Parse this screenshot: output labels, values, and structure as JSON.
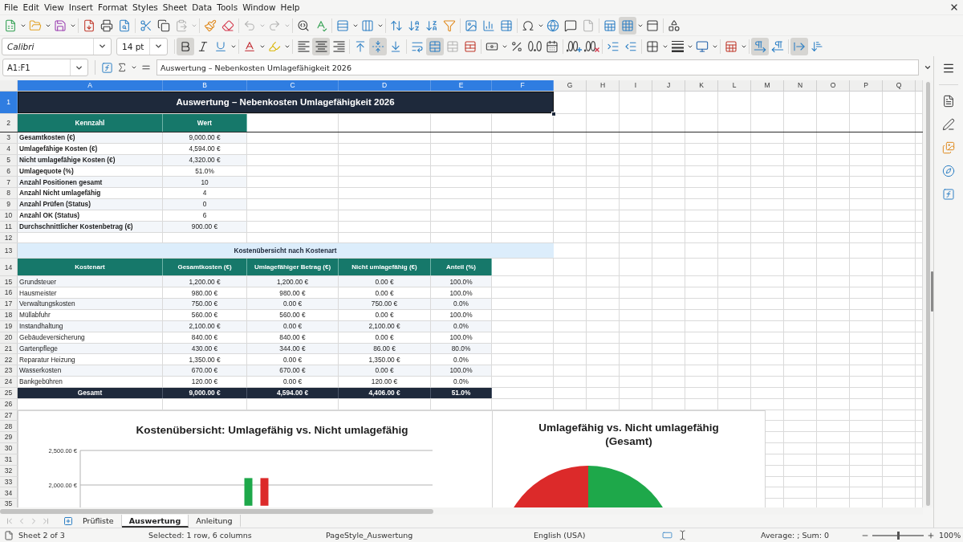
{
  "menu_bar": [
    "File",
    "Edit",
    "View",
    "Insert",
    "Format",
    "Styles",
    "Sheet",
    "Data",
    "Tools",
    "Window",
    "Help"
  ],
  "standard_toolbar": [
    [
      {
        "kind": "new",
        "on": false,
        "disabled": false,
        "dropdown": true
      },
      {
        "kind": "open",
        "on": false,
        "disabled": false,
        "dropdown": true
      },
      {
        "kind": "save",
        "on": false,
        "disabled": false,
        "dropdown": true
      }
    ],
    [
      {
        "kind": "pdf",
        "on": false,
        "disabled": false,
        "dropdown": false
      },
      {
        "kind": "print",
        "on": false,
        "disabled": false,
        "dropdown": false
      },
      {
        "kind": "preview",
        "on": false,
        "disabled": false,
        "dropdown": false
      }
    ],
    [
      {
        "kind": "cut",
        "on": false,
        "disabled": false,
        "dropdown": false
      },
      {
        "kind": "copy",
        "on": false,
        "disabled": false,
        "dropdown": false
      },
      {
        "kind": "paste",
        "on": false,
        "disabled": true,
        "dropdown": true
      }
    ],
    [
      {
        "kind": "clone",
        "on": false,
        "disabled": false,
        "dropdown": false
      },
      {
        "kind": "clear",
        "on": false,
        "disabled": false,
        "dropdown": false
      }
    ],
    [
      {
        "kind": "undo",
        "on": false,
        "disabled": true,
        "dropdown": true
      },
      {
        "kind": "redo",
        "on": false,
        "disabled": true,
        "dropdown": true
      }
    ],
    [
      {
        "kind": "find",
        "on": false,
        "disabled": false,
        "dropdown": false
      },
      {
        "kind": "spelling",
        "on": false,
        "disabled": false,
        "dropdown": false
      }
    ],
    [
      {
        "kind": "rows",
        "on": false,
        "disabled": false,
        "dropdown": true
      },
      {
        "kind": "columns",
        "on": false,
        "disabled": false,
        "dropdown": true
      }
    ],
    [
      {
        "kind": "sort",
        "on": false,
        "disabled": false,
        "dropdown": false
      },
      {
        "kind": "sort_ascending",
        "on": false,
        "disabled": false,
        "dropdown": false
      },
      {
        "kind": "sort_descending",
        "on": false,
        "disabled": false,
        "dropdown": false
      },
      {
        "kind": "autofilter",
        "on": false,
        "disabled": false,
        "dropdown": false
      }
    ],
    [
      {
        "kind": "image",
        "on": false,
        "disabled": false,
        "dropdown": false
      },
      {
        "kind": "chart",
        "on": false,
        "disabled": false,
        "dropdown": false
      },
      {
        "kind": "pivot_table",
        "on": false,
        "disabled": false,
        "dropdown": false
      }
    ],
    [
      {
        "kind": "special_character",
        "on": false,
        "disabled": false,
        "dropdown": true
      },
      {
        "kind": "hyperlink",
        "on": false,
        "disabled": false,
        "dropdown": false
      },
      {
        "kind": "comment",
        "on": false,
        "disabled": false,
        "dropdown": false
      },
      {
        "kind": "header_footer",
        "on": false,
        "disabled": true,
        "dropdown": false
      }
    ],
    [
      {
        "kind": "print_area",
        "on": false,
        "disabled": false,
        "dropdown": false
      },
      {
        "kind": "freeze",
        "on": true,
        "disabled": false,
        "dropdown": true
      },
      {
        "kind": "split_window",
        "on": false,
        "disabled": false,
        "dropdown": false
      }
    ],
    [
      {
        "kind": "draw_functions",
        "on": false,
        "disabled": false,
        "dropdown": false
      }
    ]
  ],
  "formatting_toolbar": {
    "font_name": "Calibri",
    "font_size": "14 pt",
    "groups": [
      [
        {
          "kind": "bold",
          "on": true,
          "disabled": false,
          "dropdown": false
        },
        {
          "kind": "italic",
          "on": false,
          "disabled": false,
          "dropdown": false
        },
        {
          "kind": "underline",
          "on": false,
          "disabled": false,
          "dropdown": true
        }
      ],
      [
        {
          "kind": "font_color",
          "on": false,
          "disabled": false,
          "dropdown": true
        },
        {
          "kind": "highlight",
          "on": false,
          "disabled": false,
          "dropdown": true
        }
      ],
      [
        {
          "kind": "align_left",
          "on": false,
          "disabled": false,
          "dropdown": false
        },
        {
          "kind": "align_center",
          "on": true,
          "disabled": false,
          "dropdown": false
        },
        {
          "kind": "align_right",
          "on": false,
          "disabled": false,
          "dropdown": false
        }
      ],
      [
        {
          "kind": "align_top",
          "on": false,
          "disabled": false,
          "dropdown": false
        },
        {
          "kind": "align_middle",
          "on": true,
          "disabled": false,
          "dropdown": false
        },
        {
          "kind": "align_bottom",
          "on": false,
          "disabled": false,
          "dropdown": false
        }
      ],
      [
        {
          "kind": "wrap_text",
          "on": false,
          "disabled": false,
          "dropdown": false
        },
        {
          "kind": "merge_center",
          "on": true,
          "disabled": false,
          "dropdown": false
        },
        {
          "kind": "merge_cells",
          "on": false,
          "disabled": true,
          "dropdown": false
        },
        {
          "kind": "unmerge_cells",
          "on": false,
          "disabled": false,
          "dropdown": false
        }
      ],
      [
        {
          "kind": "currency",
          "on": false,
          "disabled": false,
          "dropdown": true
        },
        {
          "kind": "percent",
          "on": false,
          "disabled": false,
          "dropdown": false
        },
        {
          "kind": "number",
          "on": false,
          "disabled": false,
          "dropdown": false
        },
        {
          "kind": "date",
          "on": false,
          "disabled": false,
          "dropdown": false
        }
      ],
      [
        {
          "kind": "add_decimal",
          "on": false,
          "disabled": false,
          "dropdown": false
        },
        {
          "kind": "delete_decimal",
          "on": false,
          "disabled": false,
          "dropdown": false
        }
      ],
      [
        {
          "kind": "indent_increase",
          "on": false,
          "disabled": false,
          "dropdown": false
        },
        {
          "kind": "indent_decrease",
          "on": false,
          "disabled": false,
          "dropdown": false
        }
      ],
      [
        {
          "kind": "borders",
          "on": false,
          "disabled": false,
          "dropdown": true
        },
        {
          "kind": "border_style",
          "on": false,
          "disabled": false,
          "dropdown": true
        },
        {
          "kind": "border_color",
          "on": false,
          "disabled": false,
          "dropdown": true
        }
      ],
      [
        {
          "kind": "conditional",
          "on": false,
          "disabled": false,
          "dropdown": true
        }
      ],
      [
        {
          "kind": "left_to_right",
          "on": true,
          "disabled": false,
          "dropdown": false
        },
        {
          "kind": "right_to_left",
          "on": false,
          "disabled": false,
          "dropdown": false
        }
      ],
      [
        {
          "kind": "text_left_to_right",
          "on": true,
          "disabled": false,
          "dropdown": false
        },
        {
          "kind": "text_top_to_bottom",
          "on": false,
          "disabled": false,
          "dropdown": false
        }
      ]
    ]
  },
  "formula_bar": {
    "name_box": "A1:F1",
    "formula": "Auswertung – Nebenkosten Umlagefähigkeit 2026"
  },
  "sheet": {
    "columns": [
      {
        "label": "A",
        "selected": true
      },
      {
        "label": "B",
        "selected": true
      },
      {
        "label": "C",
        "selected": true
      },
      {
        "label": "D",
        "selected": true
      },
      {
        "label": "E",
        "selected": true
      },
      {
        "label": "F",
        "selected": true
      },
      {
        "label": "G",
        "selected": false
      },
      {
        "label": "H",
        "selected": false
      },
      {
        "label": "I",
        "selected": false
      },
      {
        "label": "J",
        "selected": false
      },
      {
        "label": "K",
        "selected": false
      },
      {
        "label": "L",
        "selected": false
      },
      {
        "label": "M",
        "selected": false
      },
      {
        "label": "N",
        "selected": false
      },
      {
        "label": "O",
        "selected": false
      },
      {
        "label": "P",
        "selected": false
      },
      {
        "label": "Q",
        "selected": false
      }
    ],
    "row_numbers": [
      {
        "label": "1",
        "selected": true
      },
      {
        "label": "2",
        "selected": false
      },
      {
        "label": "3",
        "selected": false
      },
      {
        "label": "4",
        "selected": false
      },
      {
        "label": "5",
        "selected": false
      },
      {
        "label": "6",
        "selected": false
      },
      {
        "label": "7",
        "selected": false
      },
      {
        "label": "8",
        "selected": false
      },
      {
        "label": "9",
        "selected": false
      },
      {
        "label": "10",
        "selected": false
      },
      {
        "label": "11",
        "selected": false
      },
      {
        "label": "12",
        "selected": false
      },
      {
        "label": "13",
        "selected": false
      },
      {
        "label": "14",
        "selected": false
      },
      {
        "label": "15",
        "selected": false
      },
      {
        "label": "16",
        "selected": false
      },
      {
        "label": "17",
        "selected": false
      },
      {
        "label": "18",
        "selected": false
      },
      {
        "label": "19",
        "selected": false
      },
      {
        "label": "20",
        "selected": false
      },
      {
        "label": "21",
        "selected": false
      },
      {
        "label": "22",
        "selected": false
      },
      {
        "label": "23",
        "selected": false
      },
      {
        "label": "24",
        "selected": false
      },
      {
        "label": "25",
        "selected": false
      },
      {
        "label": "26",
        "selected": false
      },
      {
        "label": "27",
        "selected": false
      },
      {
        "label": "28",
        "selected": false
      },
      {
        "label": "29",
        "selected": false
      },
      {
        "label": "30",
        "selected": false
      },
      {
        "label": "31",
        "selected": false
      },
      {
        "label": "32",
        "selected": false
      },
      {
        "label": "33",
        "selected": false
      },
      {
        "label": "34",
        "selected": false
      },
      {
        "label": "35",
        "selected": false
      }
    ],
    "title": "Auswertung – Nebenkosten Umlagefähigkeit 2026",
    "kpi_table": {
      "columns": [
        "Kennzahl",
        "Wert"
      ],
      "rows": [
        [
          "Gesamtkosten (€)",
          "9,000.00 €"
        ],
        [
          "Umlagefähige Kosten (€)",
          "4,594.00 €"
        ],
        [
          "Nicht umlagefähige Kosten (€)",
          "4,320.00 €"
        ],
        [
          "Umlagequote (%)",
          "51.0%"
        ],
        [
          "Anzahl Positionen gesamt",
          "10"
        ],
        [
          "Anzahl Nicht umlagefähig",
          "4"
        ],
        [
          "Anzahl Prüfen (Status)",
          "0"
        ],
        [
          "Anzahl OK (Status)",
          "6"
        ],
        [
          "Durchschnittlicher Kostenbetrag (€)",
          "900.00 €"
        ]
      ]
    },
    "cost_table": {
      "title": "Kostenübersicht nach Kostenart",
      "columns": [
        "Kostenart",
        "Gesamtkosten (€)",
        "Umlagefähiger Betrag (€)",
        "Nicht umlagefähig (€)",
        "Anteil (%)"
      ],
      "rows": [
        [
          "Grundsteuer",
          "1,200.00 €",
          "1,200.00 €",
          "0.00 €",
          "100.0%"
        ],
        [
          "Hausmeister",
          "980.00 €",
          "980.00 €",
          "0.00 €",
          "100.0%"
        ],
        [
          "Verwaltungskosten",
          "750.00 €",
          "0.00 €",
          "750.00 €",
          "0.0%"
        ],
        [
          "Müllabfuhr",
          "560.00 €",
          "560.00 €",
          "0.00 €",
          "100.0%"
        ],
        [
          "Instandhaltung",
          "2,100.00 €",
          "0.00 €",
          "2,100.00 €",
          "0.0%"
        ],
        [
          "Gebäudeversicherung",
          "840.00 €",
          "840.00 €",
          "0.00 €",
          "100.0%"
        ],
        [
          "Gartenpflege",
          "430.00 €",
          "344.00 €",
          "86.00 €",
          "80.0%"
        ],
        [
          "Reparatur Heizung",
          "1,350.00 €",
          "0.00 €",
          "1,350.00 €",
          "0.0%"
        ],
        [
          "Wasserkosten",
          "670.00 €",
          "670.00 €",
          "0.00 €",
          "100.0%"
        ],
        [
          "Bankgebühren",
          "120.00 €",
          "0.00 €",
          "120.00 €",
          "0.0%"
        ]
      ],
      "total": [
        "Gesamt",
        "9,000.00 €",
        "4,594.00 €",
        "4,406.00 €",
        "51.0%"
      ]
    },
    "charts": [
      {
        "chart_data": {
          "type": "bar",
          "title": "Kostenübersicht: Umlagefähig vs. Nicht umlagefähig",
          "ylim": [
            1700,
            2500
          ],
          "yticks": [
            {
              "value": 2000,
              "label": "2,000.00 €"
            },
            {
              "value": 2500,
              "label": "2,500.00 €"
            }
          ],
          "series": [
            {
              "color": "#1ea84a",
              "values": [
                2100
              ]
            },
            {
              "values": [
                null
              ]
            },
            {
              "color": "#dc2a2a",
              "values": [
                2100
              ]
            }
          ]
        }
      },
      {
        "chart_data": {
          "type": "pie",
          "title": "Umlagefähig vs. Nicht umlagefähig (Gesamt)",
          "values": [
            51,
            49
          ],
          "colors": [
            "#1ea84a",
            "#dc2a2a"
          ]
        }
      }
    ]
  },
  "sheet_tabs": [
    {
      "label": "Prüfliste",
      "selected": false
    },
    {
      "label": "Auswertung",
      "selected": true
    },
    {
      "label": "Anleitung",
      "selected": false
    }
  ],
  "status_bar": {
    "sheet": "Sheet 2 of 3",
    "selection": "Selected: 1 row, 6 columns",
    "page_style": "PageStyle_Auswertung",
    "language": "English (USA)",
    "summary": "Average: ; Sum: 0",
    "zoom": {
      "label": "100%",
      "level": 0.5
    }
  }
}
